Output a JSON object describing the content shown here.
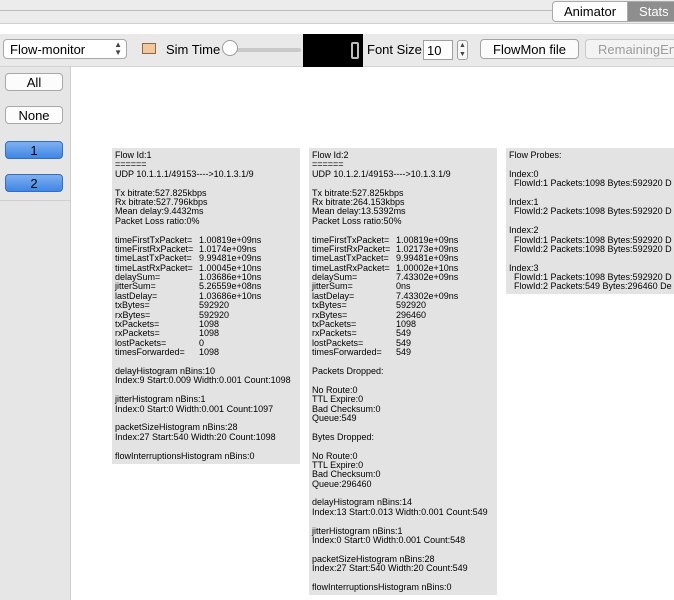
{
  "tabs": [
    {
      "label": "Animator",
      "active": false
    },
    {
      "label": "Stats",
      "active": true
    }
  ],
  "toolbar": {
    "combo_value": "Flow-monitor",
    "combo_icon": "updown-arrows",
    "doc_icon": "document-icon",
    "sim_time_label": "Sim Time",
    "sim_time_slider": 0.0,
    "font_size_label": "Font Size",
    "font_size_value": "10",
    "flowmon_button": "FlowMon file",
    "remaining_button": "RemainingEne"
  },
  "left_panel": {
    "buttons": [
      {
        "label": "All",
        "selected": false
      },
      {
        "label": "None",
        "selected": false
      },
      {
        "label": "1",
        "selected": true
      },
      {
        "label": "2",
        "selected": true
      }
    ],
    "accent": "#3f86e6"
  },
  "flow1": {
    "lines": [
      "Flow Id:1",
      "======",
      "UDP 10.1.1.1/49153---->10.1.3.1/9",
      "",
      "Tx bitrate:527.825kbps",
      "Rx bitrate:527.796kbps",
      "Mean delay:9.4432ms",
      "Packet Loss ratio:0%",
      ""
    ],
    "stats": [
      {
        "k": "timeFirstTxPacket=",
        "v": "1.00819e+09ns"
      },
      {
        "k": "timeFirstRxPacket=",
        "v": "1.0174e+09ns"
      },
      {
        "k": "timeLastTxPacket=",
        "v": "9.99481e+09ns"
      },
      {
        "k": "timeLastRxPacket=",
        "v": "1.00045e+10ns"
      },
      {
        "k": "delaySum=",
        "v": "1.03686e+10ns"
      },
      {
        "k": "jitterSum=",
        "v": "5.26559e+08ns"
      },
      {
        "k": "lastDelay=",
        "v": "1.03686e+10ns"
      },
      {
        "k": "txBytes=",
        "v": "592920"
      },
      {
        "k": "rxBytes=",
        "v": "592920"
      },
      {
        "k": "txPackets=",
        "v": "1098"
      },
      {
        "k": "rxPackets=",
        "v": "1098"
      },
      {
        "k": "lostPackets=",
        "v": "0"
      },
      {
        "k": "timesForwarded=",
        "v": "1098"
      }
    ],
    "tail": [
      "",
      "delayHistogram nBins:10",
      "Index:9 Start:0.009 Width:0.001 Count:1098",
      "",
      "jitterHistogram nBins:1",
      "Index:0 Start:0 Width:0.001 Count:1097",
      "",
      "packetSizeHistogram nBins:28",
      "Index:27 Start:540 Width:20 Count:1098",
      "",
      "flowInterruptionsHistogram nBins:0"
    ]
  },
  "flow2": {
    "lines": [
      "Flow Id:2",
      "======",
      "UDP 10.1.2.1/49153---->10.1.3.1/9",
      "",
      "Tx bitrate:527.825kbps",
      "Rx bitrate:264.153kbps",
      "Mean delay:13.5392ms",
      "Packet Loss ratio:50%",
      ""
    ],
    "stats": [
      {
        "k": "timeFirstTxPacket=",
        "v": "1.00819e+09ns"
      },
      {
        "k": "timeFirstRxPacket=",
        "v": "1.02173e+09ns"
      },
      {
        "k": "timeLastTxPacket=",
        "v": "9.99481e+09ns"
      },
      {
        "k": "timeLastRxPacket=",
        "v": "1.00002e+10ns"
      },
      {
        "k": "delaySum=",
        "v": "7.43302e+09ns"
      },
      {
        "k": "jitterSum=",
        "v": "0ns"
      },
      {
        "k": "lastDelay=",
        "v": "7.43302e+09ns"
      },
      {
        "k": "txBytes=",
        "v": "592920"
      },
      {
        "k": "rxBytes=",
        "v": "296460"
      },
      {
        "k": "txPackets=",
        "v": "1098"
      },
      {
        "k": "rxPackets=",
        "v": "549"
      },
      {
        "k": "lostPackets=",
        "v": "549"
      },
      {
        "k": "timesForwarded=",
        "v": "549"
      }
    ],
    "tail": [
      "",
      "Packets Dropped:",
      "",
      "No Route:0",
      "TTL Expire:0",
      "Bad Checksum:0",
      "Queue:549",
      "",
      "Bytes Dropped:",
      "",
      "No Route:0",
      "TTL Expire:0",
      "Bad Checksum:0",
      "Queue:296460",
      "",
      "delayHistogram nBins:14",
      "Index:13 Start:0.013 Width:0.001 Count:549",
      "",
      "jitterHistogram nBins:1",
      "Index:0 Start:0 Width:0.001 Count:548",
      "",
      "packetSizeHistogram nBins:28",
      "Index:27 Start:540 Width:20 Count:549",
      "",
      "flowInterruptionsHistogram nBins:0"
    ]
  },
  "probes": {
    "lines": [
      "Flow Probes:",
      "",
      "Index:0",
      "  FlowId:1 Packets:1098 Bytes:592920 D",
      "",
      "Index:1",
      "  FlowId:2 Packets:1098 Bytes:592920 D",
      "",
      "Index:2",
      "  FlowId:1 Packets:1098 Bytes:592920 D",
      "  FlowId:2 Packets:1098 Bytes:592920 D",
      "",
      "Index:3",
      "  FlowId:1 Packets:1098 Bytes:592920 D",
      "  FlowId:2 Packets:549 Bytes:296460 De"
    ]
  }
}
